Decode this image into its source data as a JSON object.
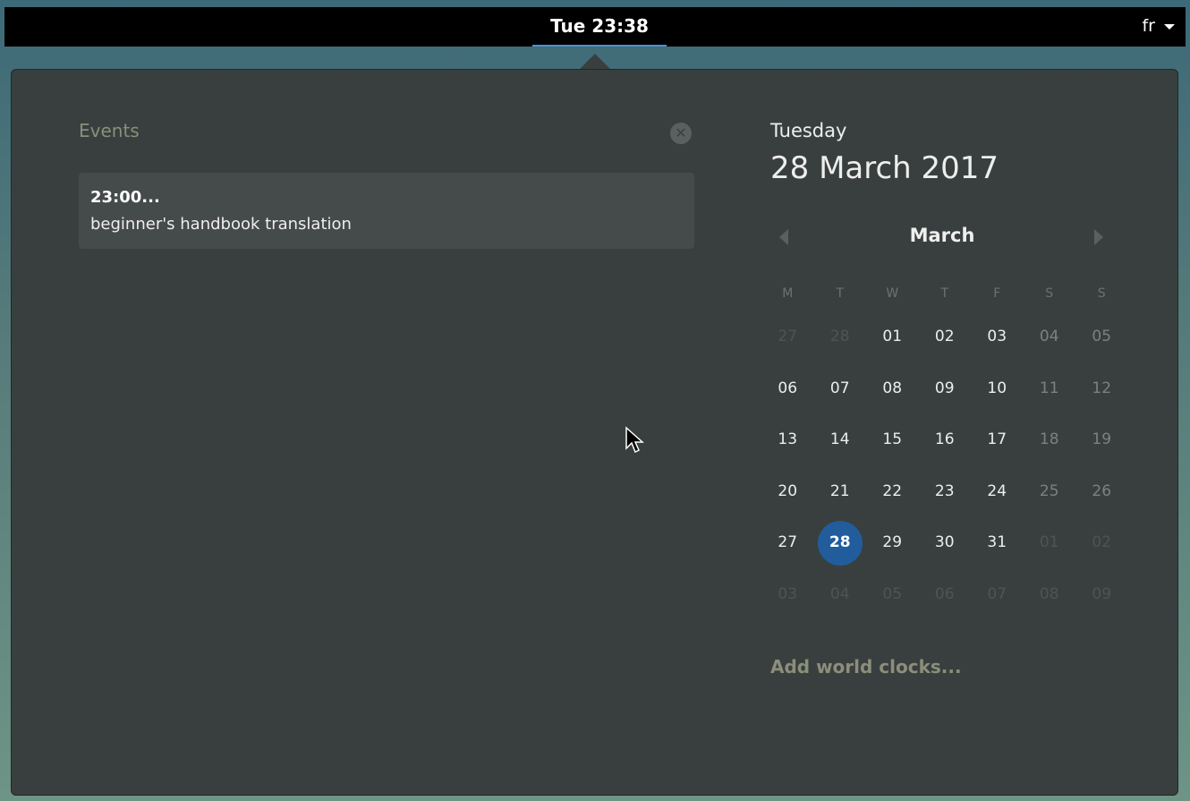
{
  "topbar": {
    "clock": "Tue 23:38",
    "language": "fr"
  },
  "events": {
    "title": "Events",
    "items": [
      {
        "time": "23:00...",
        "name": "beginner's handbook translation"
      }
    ]
  },
  "date": {
    "day": "Tuesday",
    "full": "28 March 2017"
  },
  "calendar": {
    "month": "March",
    "weekdays": [
      "M",
      "T",
      "W",
      "T",
      "F",
      "S",
      "S"
    ],
    "weeks": [
      [
        "27",
        "28",
        "01",
        "02",
        "03",
        "04",
        "05"
      ],
      [
        "06",
        "07",
        "08",
        "09",
        "10",
        "11",
        "12"
      ],
      [
        "13",
        "14",
        "15",
        "16",
        "17",
        "18",
        "19"
      ],
      [
        "20",
        "21",
        "22",
        "23",
        "24",
        "25",
        "26"
      ],
      [
        "27",
        "28",
        "29",
        "30",
        "31",
        "01",
        "02"
      ],
      [
        "03",
        "04",
        "05",
        "06",
        "07",
        "08",
        "09"
      ]
    ],
    "today": "28"
  },
  "world_clocks_label": "Add world clocks..."
}
